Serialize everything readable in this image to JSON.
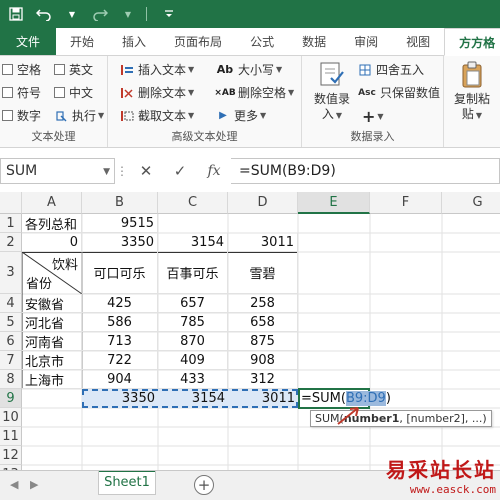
{
  "quick_access": {
    "icons": [
      "save-icon",
      "undo-icon",
      "redo-icon",
      "customize-icon"
    ]
  },
  "tabs": [
    "文件",
    "开始",
    "插入",
    "页面布局",
    "公式",
    "数据",
    "审阅",
    "视图",
    "方方格"
  ],
  "ribbon": {
    "text_processing": {
      "label": "文本处理",
      "checkboxes": [
        "空格",
        "英文",
        "符号",
        "中文",
        "数字"
      ],
      "exec_label": "执行"
    },
    "advanced_text": {
      "label": "高级文本处理",
      "insert_text": "插入文本",
      "delete_text": "删除文本",
      "cut_text": "截取文本",
      "case_label": "大小写",
      "delete_space": "删除空格",
      "more_label": "更多"
    },
    "data_entry": {
      "label": "数据录入",
      "data_entry_btn_line1": "数值录",
      "data_entry_btn_line2": "入",
      "round_label": "四舍五入",
      "keep_value": "只保留数值",
      "copy_paste_line1": "复制粘",
      "copy_paste_line2": "贴"
    }
  },
  "formula_bar": {
    "name_box": "SUM",
    "cancel_icon": "✕",
    "enter_icon": "✓",
    "fx_label": "fx",
    "formula": "=SUM(B9:D9)"
  },
  "sheet": {
    "columns": [
      "A",
      "B",
      "C",
      "D",
      "E",
      "F",
      "G"
    ],
    "rows": [
      "1",
      "2",
      "3",
      "4",
      "5",
      "6",
      "7",
      "8",
      "9",
      "10",
      "11",
      "12",
      "13"
    ],
    "r1": {
      "a": "各列总和",
      "b": "9515"
    },
    "r2": {
      "a": "0",
      "b": "3350",
      "c": "3154",
      "d": "3011"
    },
    "r3": {
      "a_top": "饮料",
      "a_bottom": "省份",
      "b": "可口可乐",
      "c": "百事可乐",
      "d": "雪碧"
    },
    "data_rows": [
      {
        "province": "安徽省",
        "b": "425",
        "c": "657",
        "d": "258"
      },
      {
        "province": "河北省",
        "b": "586",
        "c": "785",
        "d": "658"
      },
      {
        "province": "河南省",
        "b": "713",
        "c": "870",
        "d": "875"
      },
      {
        "province": "北京市",
        "b": "722",
        "c": "409",
        "d": "908"
      },
      {
        "province": "上海市",
        "b": "904",
        "c": "433",
        "d": "312"
      }
    ],
    "r9": {
      "b": "3350",
      "c": "3154",
      "d": "3011",
      "e_prefix": "=SUM(",
      "e_ref": "B9:D9",
      "e_suffix": ")"
    },
    "tooltip": {
      "fn": "SUM(",
      "arg1": "number1",
      "rest": ", [number2], ...)"
    }
  },
  "sheet_tabs": {
    "active": "Sheet1",
    "add_icon": "+"
  },
  "watermark": {
    "line1": "易采站长站",
    "line2": "www.easck.com"
  },
  "colors": {
    "excel_green": "#217346",
    "selection_blue": "#2f6fb5",
    "watermark_red": "#c01818"
  }
}
